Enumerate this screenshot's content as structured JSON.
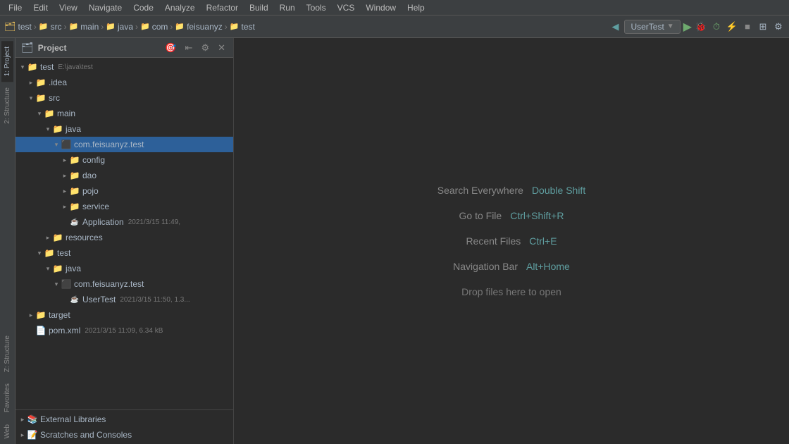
{
  "menubar": {
    "items": [
      "File",
      "Edit",
      "View",
      "Navigate",
      "Code",
      "Analyze",
      "Refactor",
      "Build",
      "Run",
      "Tools",
      "VCS",
      "Window",
      "Help"
    ]
  },
  "toolbar": {
    "breadcrumbs": [
      {
        "label": "test",
        "icon": "project"
      },
      {
        "label": "src",
        "icon": "folder"
      },
      {
        "label": "main",
        "icon": "folder"
      },
      {
        "label": "java",
        "icon": "folder"
      },
      {
        "label": "com",
        "icon": "folder"
      },
      {
        "label": "feisuanyz",
        "icon": "folder"
      },
      {
        "label": "test",
        "icon": "folder"
      }
    ],
    "run_config": "UserTest",
    "run_label": "▶"
  },
  "project_panel": {
    "title": "Project",
    "tree": [
      {
        "id": "root",
        "label": "test",
        "meta": "E:\\java\\test",
        "indent": 0,
        "expanded": true,
        "icon": "project"
      },
      {
        "id": "idea",
        "label": ".idea",
        "indent": 1,
        "expanded": false,
        "icon": "folder-blue"
      },
      {
        "id": "src",
        "label": "src",
        "indent": 1,
        "expanded": true,
        "icon": "folder-yellow"
      },
      {
        "id": "main",
        "label": "main",
        "indent": 2,
        "expanded": true,
        "icon": "folder-yellow"
      },
      {
        "id": "java",
        "label": "java",
        "indent": 3,
        "expanded": true,
        "icon": "folder-blue"
      },
      {
        "id": "com",
        "label": "com.feisuanyz.test",
        "indent": 4,
        "expanded": true,
        "icon": "pkg",
        "selected": true
      },
      {
        "id": "config",
        "label": "config",
        "indent": 5,
        "expanded": false,
        "icon": "folder-yellow"
      },
      {
        "id": "dao",
        "label": "dao",
        "indent": 5,
        "expanded": false,
        "icon": "folder-yellow"
      },
      {
        "id": "pojo",
        "label": "pojo",
        "indent": 5,
        "expanded": false,
        "icon": "folder-yellow"
      },
      {
        "id": "service",
        "label": "service",
        "indent": 5,
        "expanded": false,
        "icon": "folder-yellow"
      },
      {
        "id": "app",
        "label": "Application",
        "meta": "2021/3/15 11:49,",
        "indent": 5,
        "icon": "java"
      },
      {
        "id": "resources",
        "label": "resources",
        "indent": 3,
        "expanded": false,
        "icon": "folder-orange"
      },
      {
        "id": "test",
        "label": "test",
        "indent": 2,
        "expanded": true,
        "icon": "folder-yellow"
      },
      {
        "id": "testjava",
        "label": "java",
        "indent": 3,
        "expanded": true,
        "icon": "folder-blue"
      },
      {
        "id": "testpkg",
        "label": "com.feisuanyz.test",
        "indent": 4,
        "expanded": true,
        "icon": "pkg"
      },
      {
        "id": "usertest",
        "label": "UserTest",
        "meta": "2021/3/15 11:50, 1.3...",
        "indent": 5,
        "icon": "java"
      },
      {
        "id": "target",
        "label": "target",
        "indent": 1,
        "expanded": false,
        "icon": "folder-orange"
      },
      {
        "id": "pomxml",
        "label": "pom.xml",
        "meta": "2021/3/15 11:09, 6.34 kB",
        "indent": 1,
        "icon": "xml"
      }
    ],
    "bottom_items": [
      {
        "label": "External Libraries",
        "icon": "lib"
      },
      {
        "label": "Scratches and Consoles",
        "icon": "scratch"
      }
    ]
  },
  "editor": {
    "hints": [
      {
        "label": "Search Everywhere",
        "shortcut": "Double Shift"
      },
      {
        "label": "Go to File",
        "shortcut": "Ctrl+Shift+R"
      },
      {
        "label": "Recent Files",
        "shortcut": "Ctrl+E"
      },
      {
        "label": "Navigation Bar",
        "shortcut": "Alt+Home"
      }
    ],
    "drop_hint": "Drop files here to open"
  },
  "side_tabs_left": [
    {
      "label": "1: Project",
      "active": true
    },
    {
      "label": "2: Structure"
    },
    {
      "label": "Z: Structure"
    },
    {
      "label": "Favorites"
    },
    {
      "label": "Web"
    }
  ]
}
